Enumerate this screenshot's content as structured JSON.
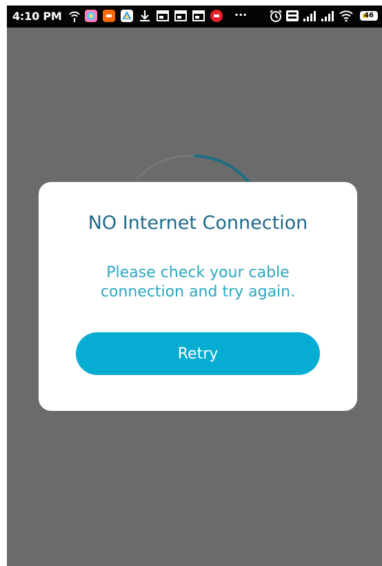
{
  "status_bar": {
    "time": "4:10 PM",
    "overflow_dots": "···",
    "battery_level": "46",
    "icons": [
      "hotspot-icon",
      "gallery-app-icon",
      "mi-app-icon",
      "drive-app-icon",
      "download-icon",
      "window-icon",
      "window-icon",
      "window-icon",
      "jio-app-icon",
      "alarm-icon",
      "volte-icon",
      "signal-icon",
      "signal-icon",
      "wifi-icon",
      "battery-icon"
    ]
  },
  "dialog": {
    "title": "NO Internet Connection",
    "message": "Please check your cable connection and try again.",
    "retry_label": "Retry"
  },
  "colors": {
    "background_overlay": "#6b6b6b",
    "title": "#1e6a8a",
    "message": "#2aa7c2",
    "button": "#07acd2",
    "spinner": "#1b6e86"
  }
}
